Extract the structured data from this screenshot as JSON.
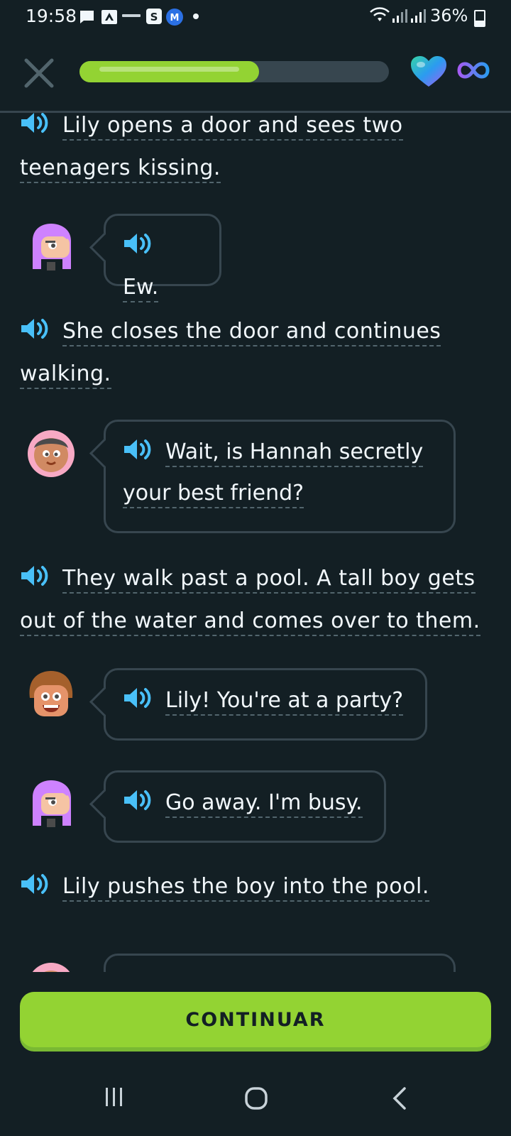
{
  "status_bar": {
    "time": "19:58",
    "notification_icons": [
      "message-icon",
      "drive-icon",
      "coursera-icon",
      "s-app-icon",
      "m-app-icon",
      "dot-icon"
    ],
    "battery": "36%",
    "icons": [
      "wifi-icon",
      "signal-icon",
      "signal-icon",
      "battery-icon"
    ]
  },
  "lesson": {
    "progress_fraction": 0.58,
    "hearts_icon": "heart-icon",
    "hearts_value": "infinity-icon",
    "accent_color": "#93d333"
  },
  "story": {
    "narration_1_line1": "Lily opens a door and sees two",
    "narration_1_line2": "teenagers kissing.",
    "bubble_1": "Ew.",
    "narration_2_line1": "She closes the door and continues",
    "narration_2_line2": "walking.",
    "bubble_2_line1": "Wait, is Hannah secretly",
    "bubble_2_line2": "your best friend?",
    "narration_3_line1": "They walk past a pool. A tall boy gets",
    "narration_3_line2": "out of the water and comes over to them.",
    "bubble_3": "Lily! You're at a party?",
    "bubble_4": "Go away. I'm busy.",
    "narration_4": "Lily pushes the boy into the pool."
  },
  "continue_label": "CONTINUAR",
  "nav": {
    "icons": [
      "recent-apps-icon",
      "home-icon",
      "back-icon"
    ]
  }
}
